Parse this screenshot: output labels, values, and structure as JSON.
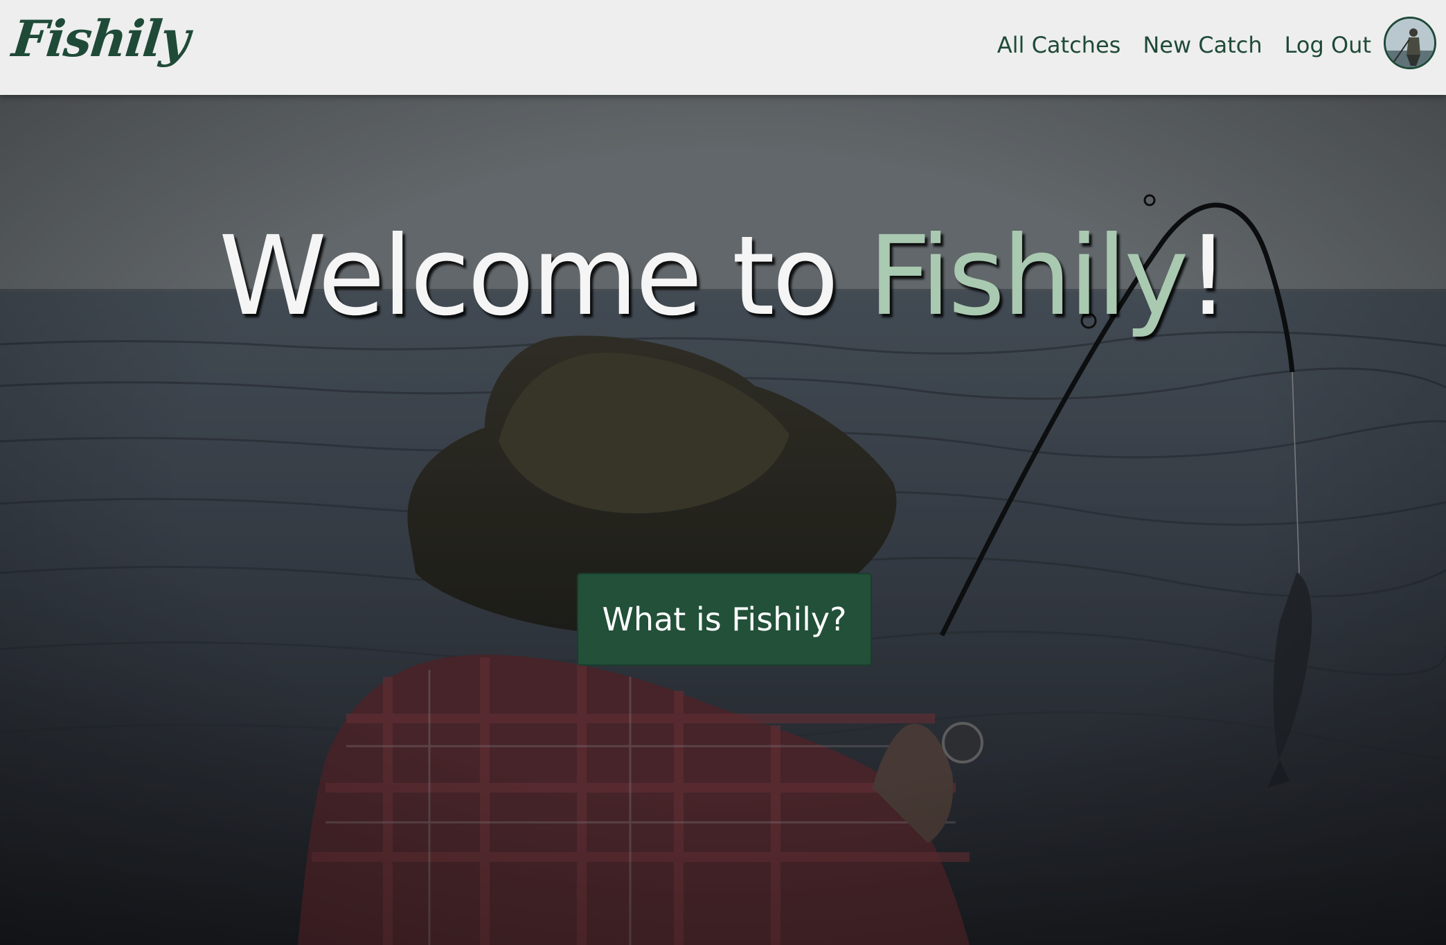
{
  "navbar": {
    "brand": "Fishily",
    "links": [
      {
        "label": "All Catches"
      },
      {
        "label": "New Catch"
      },
      {
        "label": "Log Out"
      }
    ]
  },
  "hero": {
    "title_main": "Welcome to ",
    "title_accent": "Fishily",
    "title_end": "!",
    "cta_label": "What is Fishily?"
  },
  "colors": {
    "brand_green": "#1f4a38",
    "accent_green": "#a9c9b1",
    "button_green": "#225039",
    "navbar_bg": "#eeeeee"
  }
}
